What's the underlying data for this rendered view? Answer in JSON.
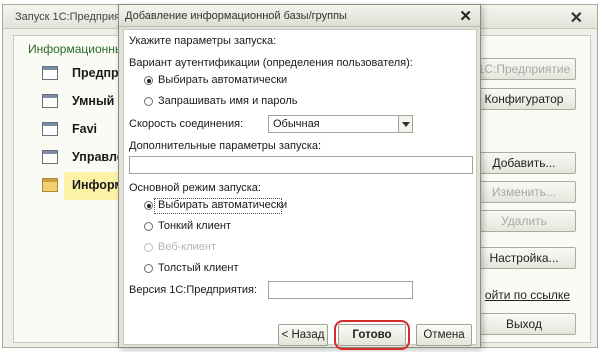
{
  "background_window": {
    "title": "Запуск 1С:Предприятия",
    "list_header": "Информационны",
    "items": [
      {
        "label": "Предприя"
      },
      {
        "label": "Умный б"
      },
      {
        "label": "Favi"
      },
      {
        "label": "Управле"
      },
      {
        "label": "Информа"
      }
    ],
    "buttons": {
      "enterprise": "1С:Предприятие",
      "configurator": "Конфигуратор",
      "add": "Добавить...",
      "edit": "Изменить...",
      "delete": "Удалить",
      "settings": "Настройка...",
      "exit": "Выход"
    },
    "link": "ойти по ссылке"
  },
  "dialog": {
    "title": "Добавление информационной базы/группы",
    "section_title": "Укажите параметры запуска:",
    "auth_label": "Вариант аутентификации (определения пользователя):",
    "auth_options": [
      {
        "label": "Выбирать автоматически",
        "selected": true
      },
      {
        "label": "Запрашивать имя и пароль",
        "selected": false
      }
    ],
    "speed_label": "Скорость соединения:",
    "speed_value": "Обычная",
    "extra_params_label": "Дополнительные параметры запуска:",
    "extra_params_value": "",
    "mode_label": "Основной режим запуска:",
    "mode_options": [
      {
        "label": "Выбирать автоматически",
        "selected": true,
        "disabled": false
      },
      {
        "label": "Тонкий клиент",
        "selected": false,
        "disabled": false
      },
      {
        "label": "Веб-клиент",
        "selected": false,
        "disabled": true
      },
      {
        "label": "Толстый клиент",
        "selected": false,
        "disabled": false
      }
    ],
    "version_label": "Версия 1С:Предприятия:",
    "version_value": "",
    "back_button": "< Назад",
    "done_button": "Готово",
    "cancel_button": "Отмена"
  },
  "colors": {
    "highlight_ring": "#d42a2a",
    "selected_item_bg": "#fdf3a6",
    "list_header": "#2a6a2a"
  }
}
